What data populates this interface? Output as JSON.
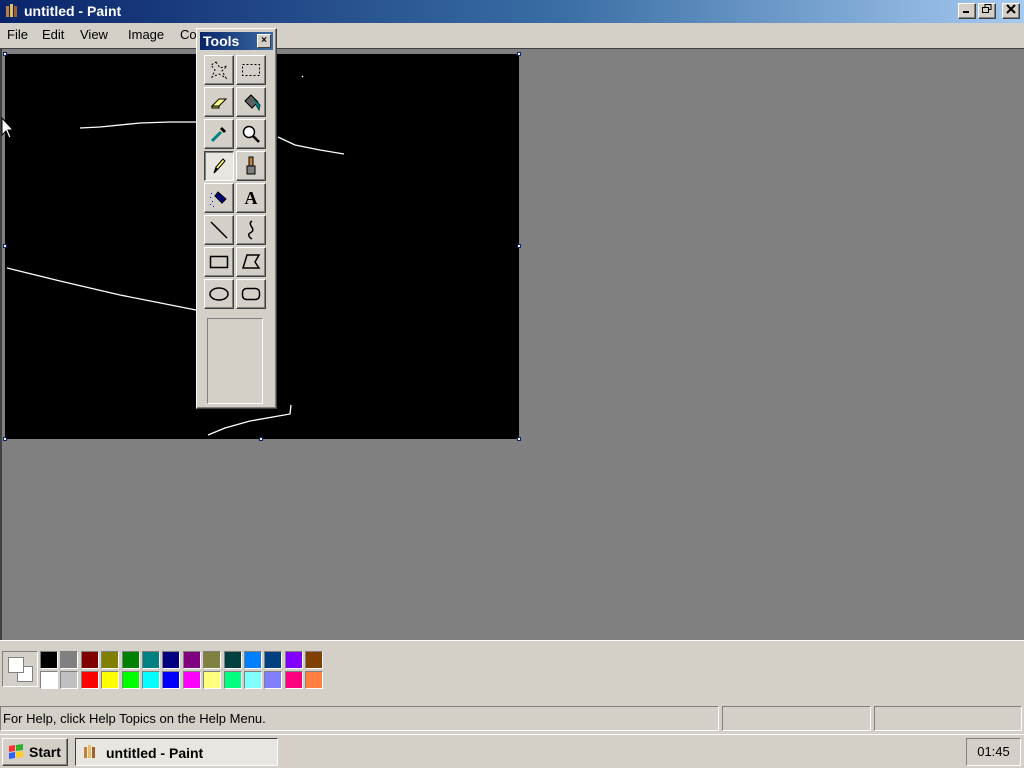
{
  "window": {
    "title": "untitled - Paint"
  },
  "menu": {
    "items": [
      "File",
      "Edit",
      "View",
      "Image",
      "Co"
    ]
  },
  "tools": {
    "title": "Tools",
    "close_glyph": "×",
    "items": [
      {
        "name": "free-form-select",
        "icon": "free-form-select-icon"
      },
      {
        "name": "select",
        "icon": "rect-select-icon"
      },
      {
        "name": "eraser",
        "icon": "eraser-icon"
      },
      {
        "name": "fill-with-color",
        "icon": "paint-bucket-icon"
      },
      {
        "name": "pick-color",
        "icon": "eyedropper-icon"
      },
      {
        "name": "magnifier",
        "icon": "magnifier-icon"
      },
      {
        "name": "pencil",
        "icon": "pencil-icon",
        "active": true
      },
      {
        "name": "brush",
        "icon": "brush-icon"
      },
      {
        "name": "airbrush",
        "icon": "airbrush-icon"
      },
      {
        "name": "text",
        "icon": "text-icon",
        "glyph": "A"
      },
      {
        "name": "line",
        "icon": "line-icon"
      },
      {
        "name": "curve",
        "icon": "curve-icon"
      },
      {
        "name": "rectangle",
        "icon": "rectangle-icon"
      },
      {
        "name": "polygon",
        "icon": "polygon-icon"
      },
      {
        "name": "ellipse",
        "icon": "ellipse-icon"
      },
      {
        "name": "rounded-rectangle",
        "icon": "rounded-rectangle-icon"
      }
    ]
  },
  "colors": {
    "foreground": "#ffffff",
    "background": "#ffffff",
    "canvas_bg": "#000000",
    "stroke": "#ffffff",
    "palette_top": [
      "#000000",
      "#808080",
      "#800000",
      "#808000",
      "#008000",
      "#008080",
      "#000080",
      "#800080",
      "#808040",
      "#004040",
      "#0080ff",
      "#004080",
      "#8000ff",
      "#804000"
    ],
    "palette_bottom": [
      "#ffffff",
      "#c0c0c0",
      "#ff0000",
      "#ffff00",
      "#00ff00",
      "#00ffff",
      "#0000ff",
      "#ff00ff",
      "#ffff80",
      "#00ff80",
      "#80ffff",
      "#8080ff",
      "#ff0080",
      "#ff8040"
    ]
  },
  "status": {
    "help": "For Help, click Help Topics on the Help Menu.",
    "coords": "",
    "size": ""
  },
  "taskbar": {
    "start_label": "Start",
    "task_label": "untitled - Paint",
    "clock": "01:45"
  }
}
